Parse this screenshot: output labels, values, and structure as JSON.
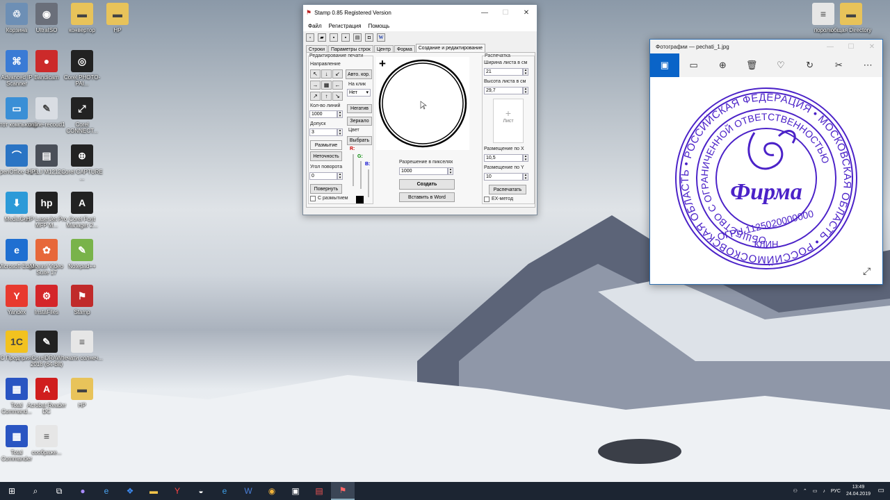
{
  "desktop_icons": [
    {
      "label": "Корзина",
      "icon": "recycle-bin-icon",
      "color": "#6d8fb5",
      "glyph": "♲"
    },
    {
      "label": "UltraISO",
      "icon": "disc-icon",
      "color": "#6a6f7a",
      "glyph": "◉"
    },
    {
      "label": "конвертор",
      "icon": "folder-icon",
      "color": "#e8c35a",
      "glyph": "▬"
    },
    {
      "label": "HP",
      "icon": "folder-icon",
      "color": "#e8c35a",
      "glyph": "▬"
    },
    {
      "label": "Advanced IP Scanner",
      "icon": "network-scanner-icon",
      "color": "#3a7bd5",
      "glyph": "⌘"
    },
    {
      "label": "Bandicam",
      "icon": "bandicam-icon",
      "color": "#cc2a2a",
      "glyph": "●"
    },
    {
      "label": "Corel PHOTO-PAI...",
      "icon": "corel-photopaint-icon",
      "color": "#222222",
      "glyph": "◎"
    },
    {
      "label": "Этот компьютер",
      "icon": "computer-icon",
      "color": "#3a8fd6",
      "glyph": "▭"
    },
    {
      "label": "online-recoud1",
      "icon": "document-icon",
      "color": "#d9dde3",
      "glyph": "✎"
    },
    {
      "label": "Corel CONNECT...",
      "icon": "corel-connect-icon",
      "color": "#222222",
      "glyph": "⤢"
    },
    {
      "label": "OpenOffice 4.1.5",
      "icon": "openoffice-icon",
      "color": "#2a74c4",
      "glyph": "⌒"
    },
    {
      "label": "HP LJ M1212...",
      "icon": "printer-icon",
      "color": "#4a4f58",
      "glyph": "▤"
    },
    {
      "label": "Corel CAPTURE ...",
      "icon": "corel-capture-icon",
      "color": "#222222",
      "glyph": "⊕"
    },
    {
      "label": "MediaGet",
      "icon": "mediaget-icon",
      "color": "#2c9ad8",
      "glyph": "⬇"
    },
    {
      "label": "HP LaserJet Pro MFP M...",
      "icon": "hp-icon",
      "color": "#222222",
      "glyph": "hp"
    },
    {
      "label": "Corel Font Manager 2...",
      "icon": "corel-font-icon",
      "color": "#222222",
      "glyph": "A"
    },
    {
      "label": "Microsoft Edge",
      "icon": "edge-icon",
      "color": "#1f6fd1",
      "glyph": "e"
    },
    {
      "label": "Movavi Video Suite 17",
      "icon": "movavi-icon",
      "color": "#e7683a",
      "glyph": "✿"
    },
    {
      "label": "Notepad++",
      "icon": "notepad-icon",
      "color": "#79b34a",
      "glyph": "✎"
    },
    {
      "label": "Yandex",
      "icon": "yandex-icon",
      "color": "#e83a2f",
      "glyph": "Y"
    },
    {
      "label": "InstaFiles",
      "icon": "instafiles-icon",
      "color": "#d4262a",
      "glyph": "⚙"
    },
    {
      "label": "Stamp",
      "icon": "stamp-icon",
      "color": "#c02a2a",
      "glyph": "⚑"
    },
    {
      "label": "1С Предприя...",
      "icon": "1c-icon",
      "color": "#f2c21f",
      "glyph": "1С"
    },
    {
      "label": "CorelDRAW 2018 (64-Bit)",
      "icon": "coreldraw-icon",
      "color": "#222222",
      "glyph": "✎"
    },
    {
      "label": "печати солнеч...",
      "icon": "text-file-icon",
      "color": "#e6e6e6",
      "glyph": "≡"
    },
    {
      "label": "Total Command...",
      "icon": "total-commander-icon",
      "color": "#2a55c2",
      "glyph": "▦"
    },
    {
      "label": "Acrobat Reader DC",
      "icon": "acrobat-icon",
      "color": "#d01e1e",
      "glyph": "A"
    },
    {
      "label": "HP",
      "icon": "folder-icon",
      "color": "#e8c35a",
      "glyph": "▬"
    },
    {
      "label": "Total Commander",
      "icon": "total-commander-icon",
      "color": "#2a55c2",
      "glyph": "▦"
    },
    {
      "label": "соображе...",
      "icon": "text-file-icon",
      "color": "#e6e6e6",
      "glyph": "≡"
    },
    {
      "label": "пороль",
      "icon": "text-file-icon",
      "color": "#e6e6e6",
      "glyph": "≡"
    },
    {
      "label": "общая Directory",
      "icon": "folder-icon",
      "color": "#e8c35a",
      "glyph": "▬"
    }
  ],
  "stamp_window": {
    "title": "Stamp 0.85 Registered Version",
    "menu": [
      "Файл",
      "Регистрация",
      "Помощь"
    ],
    "tabs": [
      "Строки",
      "Параметры строк",
      "Центр",
      "Форма",
      "Создание и редактирование"
    ],
    "edit_group": "Редактирование печати",
    "direction": "Направление",
    "auto_btn": "Авто. кор.",
    "on_click": "На клик",
    "on_click_value": "Нет",
    "lines_count_label": "Кол-во линий",
    "lines_count": "1000",
    "tolerance_label": "Допуск",
    "tolerance": "3",
    "negative_btn": "Негатив",
    "mirror_btn": "Зеркало",
    "color_label": "Цвет",
    "choose_btn": "Выбрать",
    "blur_btn": "Размытие",
    "sharp_btn": "Неточность",
    "r": "R:",
    "g": "G:",
    "b": "B:",
    "angle_label": "Угол поворота",
    "angle": "0",
    "rotate_btn": "Повернуть",
    "with_blur": "С размытием",
    "res_label": "Разрешение в пикселях",
    "res": "1000",
    "create_btn": "Создать",
    "word_btn": "Вставить в Word",
    "plus": "+",
    "print_group": "Распечатка",
    "sheet_w_label": "Ширина листа в см",
    "sheet_w": "21",
    "sheet_h_label": "Высота листа в см",
    "sheet_h": "29,7",
    "sheet_label": "Лист",
    "pos_x_label": "Размещение по X",
    "pos_x": "10,5",
    "pos_y_label": "Размещение по Y",
    "pos_y": "10",
    "print_btn": "Распечатать",
    "ex_method": "EX-метод"
  },
  "photos_window": {
    "title": "Фотографии — pechati_1.jpg",
    "stamp_color": "#4b22c8",
    "outer_text": "МОСКОВСКАЯ ОБЛАСТЬ • РОССИЙСКАЯ ФЕДЕРАЦИЯ • МОСКОВСКАЯ ОБЛАСТЬ • РОССИЙСКАЯ ФЕДЕРАЦИЯ •",
    "inner_text": "ОБЩЕСТВО С ОГРАНИЧЕННОЙ ОТВЕТСТВЕННОСТЬЮ",
    "center_text": "Фирма",
    "ogrn": "ОГРН 1125020000000",
    "city": "КЛИН"
  },
  "taskbar": {
    "lang": "РУС",
    "time": "13:49",
    "date": "24.04.2019"
  }
}
